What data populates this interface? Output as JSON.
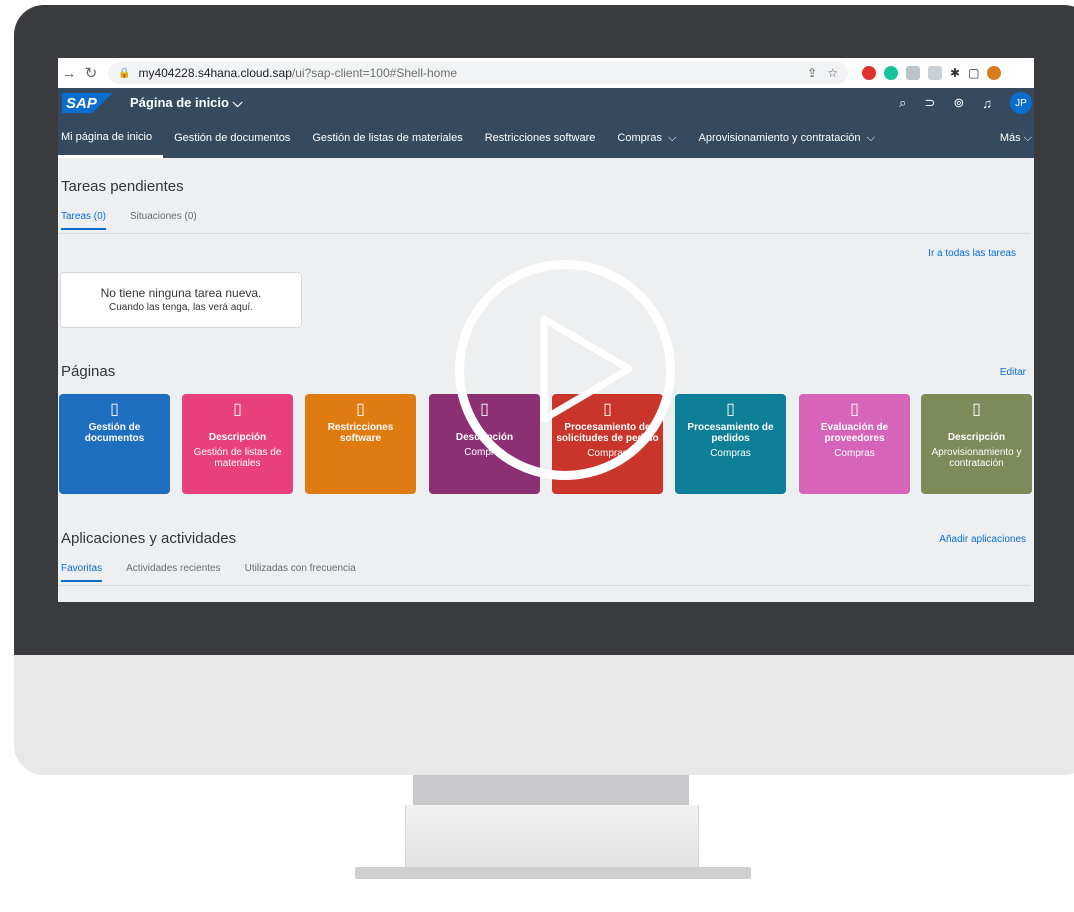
{
  "browser": {
    "url_host": "my404228.s4hana.cloud.sap",
    "url_path": "/ui?sap-client=100#Shell-home"
  },
  "shell": {
    "logo": "SAP",
    "title": "Página de inicio",
    "avatar": "JP"
  },
  "tabs": [
    {
      "label": "Mi página de inicio"
    },
    {
      "label": "Gestión de documentos"
    },
    {
      "label": "Gestión de listas de materiales"
    },
    {
      "label": "Restricciones software"
    },
    {
      "label": "Compras"
    },
    {
      "label": "Aprovisionamiento y contratación"
    }
  ],
  "tabs_more": "Más",
  "tasks": {
    "title": "Tareas pendientes",
    "tab_tasks": "Tareas (0)",
    "tab_situations": "Situaciones (0)",
    "all_link": "Ir a todas las tareas",
    "empty_title": "No tiene ninguna tarea nueva.",
    "empty_sub": "Cuando las tenga, las verá aquí."
  },
  "pages": {
    "title": "Páginas",
    "edit_link": "Editar",
    "tiles": [
      {
        "title": "Gestión de documentos",
        "sub": "",
        "color": "#1f6fc0"
      },
      {
        "title": "Descripción",
        "sub": "Gestión de listas de materiales",
        "color": "#e8407a"
      },
      {
        "title": "Restricciones software",
        "sub": "",
        "color": "#e07b12"
      },
      {
        "title": "Descripción",
        "sub": "Compras",
        "color": "#8c2f73"
      },
      {
        "title": "Procesamiento de solicitudes de pedido",
        "sub": "Compras",
        "color": "#c9352b"
      },
      {
        "title": "Procesamiento de pedidos",
        "sub": "Compras",
        "color": "#0d8098"
      },
      {
        "title": "Evaluación de proveedores",
        "sub": "Compras",
        "color": "#d664b8"
      },
      {
        "title": "Descripción",
        "sub": "Aprovisionamiento y contratación",
        "color": "#7d8a5a"
      }
    ]
  },
  "apps": {
    "title": "Aplicaciones y actividades",
    "add_link": "Añadir aplicaciones",
    "tab_favorites": "Favoritas",
    "tab_recent": "Actividades recientes",
    "tab_frequent": "Utilizadas con frecuencia"
  }
}
